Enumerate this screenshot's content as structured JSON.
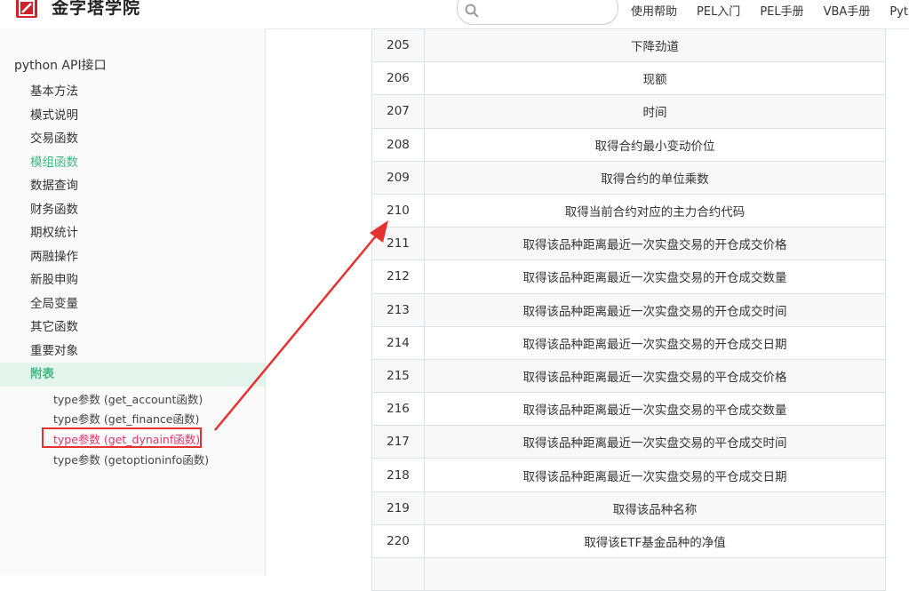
{
  "header": {
    "logo_text": "金字塔学院",
    "search_placeholder": "",
    "nav": [
      "使用帮助",
      "PEL入门",
      "PEL手册",
      "VBA手册",
      "Pytho"
    ]
  },
  "sidebar": {
    "title": "python API接口",
    "items": [
      {
        "label": "基本方法",
        "state": "normal"
      },
      {
        "label": "模式说明",
        "state": "normal"
      },
      {
        "label": "交易函数",
        "state": "normal"
      },
      {
        "label": "模组函数",
        "state": "green"
      },
      {
        "label": "数据查询",
        "state": "normal"
      },
      {
        "label": "财务函数",
        "state": "normal"
      },
      {
        "label": "期权统计",
        "state": "normal"
      },
      {
        "label": "两融操作",
        "state": "normal"
      },
      {
        "label": "新股申购",
        "state": "normal"
      },
      {
        "label": "全局变量",
        "state": "normal"
      },
      {
        "label": "其它函数",
        "state": "normal"
      },
      {
        "label": "重要对象",
        "state": "normal"
      },
      {
        "label": "附表",
        "state": "active"
      }
    ],
    "sub_items": [
      {
        "label": "type参数 (get_account函数)",
        "current": false
      },
      {
        "label": "type参数 (get_finance函数)",
        "current": false
      },
      {
        "label": "type参数 (get_dynainf函数)",
        "current": true
      },
      {
        "label": "type参数 (getoptioninfo函数)",
        "current": false
      }
    ]
  },
  "table": {
    "rows": [
      {
        "num": "205",
        "desc": "下降劲道"
      },
      {
        "num": "206",
        "desc": "现额"
      },
      {
        "num": "207",
        "desc": "时间"
      },
      {
        "num": "208",
        "desc": "取得合约最小变动价位"
      },
      {
        "num": "209",
        "desc": "取得合约的单位乘数"
      },
      {
        "num": "210",
        "desc": "取得当前合约对应的主力合约代码"
      },
      {
        "num": "211",
        "desc": "取得该品种距离最近一次实盘交易的开仓成交价格"
      },
      {
        "num": "212",
        "desc": "取得该品种距离最近一次实盘交易的开仓成交数量"
      },
      {
        "num": "213",
        "desc": "取得该品种距离最近一次实盘交易的开仓成交时间"
      },
      {
        "num": "214",
        "desc": "取得该品种距离最近一次实盘交易的开仓成交日期"
      },
      {
        "num": "215",
        "desc": "取得该品种距离最近一次实盘交易的平仓成交价格"
      },
      {
        "num": "216",
        "desc": "取得该品种距离最近一次实盘交易的平仓成交数量"
      },
      {
        "num": "217",
        "desc": "取得该品种距离最近一次实盘交易的平仓成交时间"
      },
      {
        "num": "218",
        "desc": "取得该品种距离最近一次实盘交易的平仓成交日期"
      },
      {
        "num": "219",
        "desc": "取得该品种名称"
      },
      {
        "num": "220",
        "desc": "取得该ETF基金品种的净值"
      },
      {
        "num": "",
        "desc": ""
      }
    ]
  },
  "colors": {
    "accent_green": "#42b983",
    "active_bg": "#e3f4ec",
    "annotation_red": "#e5322f",
    "current_link": "#e3366b",
    "logo_red": "#d0202a"
  }
}
